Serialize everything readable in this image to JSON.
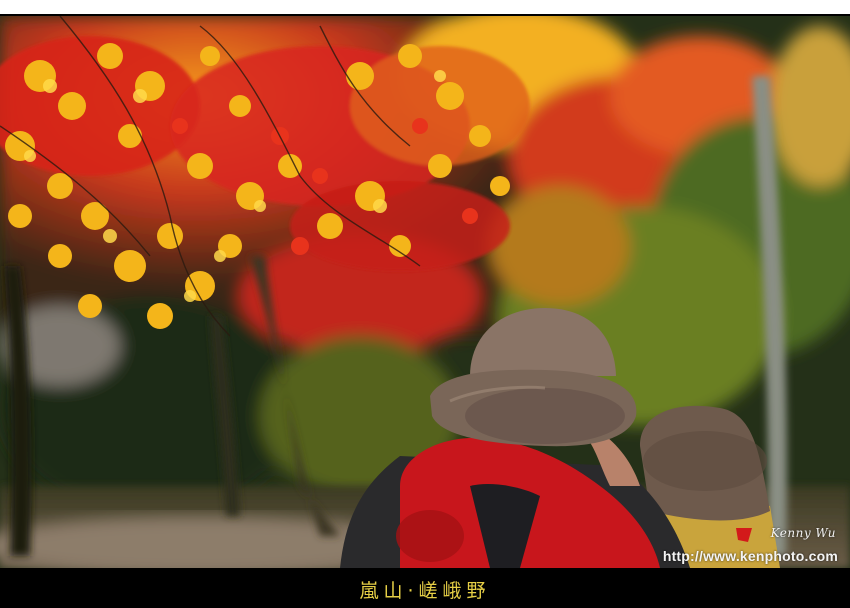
{
  "photo": {
    "subject": "autumn-maple-visitors-photo",
    "palette": {
      "frame": "#000000",
      "maple_red": "#d8261c",
      "maple_yellow": "#f4b51a",
      "foliage_green": "#5d7a24",
      "hat_brown": "#6e5a4c",
      "jacket_red": "#c8161c"
    }
  },
  "watermark": {
    "signature": "Kenny Wu",
    "url": "http://www.kenphoto.com"
  },
  "caption": {
    "text": "嵐山‧嵯峨野",
    "color": "#e6cf46"
  }
}
